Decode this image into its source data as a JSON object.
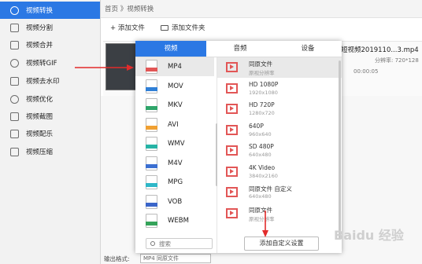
{
  "colors": {
    "accent": "#2b78e4",
    "red_arrow": "#e22b2b"
  },
  "sidebar": {
    "items": [
      {
        "label": "视频转换",
        "icon": "convert-icon",
        "active": true
      },
      {
        "label": "视频分割",
        "icon": "split-icon"
      },
      {
        "label": "视频合并",
        "icon": "merge-icon"
      },
      {
        "label": "视频转GIF",
        "icon": "gif-play-icon"
      },
      {
        "label": "视频去水印",
        "icon": "watermark-icon"
      },
      {
        "label": "视频优化",
        "icon": "optimize-icon"
      },
      {
        "label": "视频截图",
        "icon": "screenshot-icon"
      },
      {
        "label": "视频配乐",
        "icon": "music-icon"
      },
      {
        "label": "视频压缩",
        "icon": "compress-icon"
      }
    ]
  },
  "header": {
    "breadcrumb": "首页 》视频转换"
  },
  "toolbar": {
    "add_file": "+ 添加文件",
    "add_folder": "添加文件夹"
  },
  "file": {
    "name": "短视频2019110...3.mp4",
    "meta_resolution": "分辨率: 720*128",
    "meta_duration": "00:00:05"
  },
  "popup": {
    "tabs": [
      "视频",
      "音频",
      "设备"
    ],
    "formats": [
      {
        "label": "MP4",
        "tag": "MP4",
        "color": "#e25656",
        "selected": true
      },
      {
        "label": "MOV",
        "tag": "MOV",
        "color": "#2f7fd6"
      },
      {
        "label": "MKV",
        "tag": "MKV",
        "color": "#2fa56a"
      },
      {
        "label": "AVI",
        "tag": "AVI",
        "color": "#f0a032"
      },
      {
        "label": "WMV",
        "tag": "WMV",
        "color": "#26b3a5"
      },
      {
        "label": "M4V",
        "tag": "M4V",
        "color": "#3b6fd1"
      },
      {
        "label": "MPG",
        "tag": "MPG",
        "color": "#2fb7c8"
      },
      {
        "label": "VOB",
        "tag": "VOB",
        "color": "#3a65c9"
      },
      {
        "label": "WEBM",
        "tag": "WEBM",
        "color": "#35a35a"
      }
    ],
    "search_placeholder": "搜索",
    "resolutions": [
      {
        "title": "同原文件",
        "sub": "原视分辨率",
        "selected": true
      },
      {
        "title": "HD 1080P",
        "sub": "1920x1080"
      },
      {
        "title": "HD 720P",
        "sub": "1280x720"
      },
      {
        "title": "640P",
        "sub": "960x640"
      },
      {
        "title": "SD 480P",
        "sub": "640x480"
      },
      {
        "title": "4K Video",
        "sub": "3840x2160"
      },
      {
        "title": "同原文件 自定义",
        "sub": "640x480"
      },
      {
        "title": "同原文件",
        "sub": "原视分辨率"
      }
    ],
    "custom_button": "添加自定义设置"
  },
  "bottom": {
    "label": "输出格式:",
    "select_value": "MP4 同原文件"
  },
  "watermark": "Baidu 经验"
}
